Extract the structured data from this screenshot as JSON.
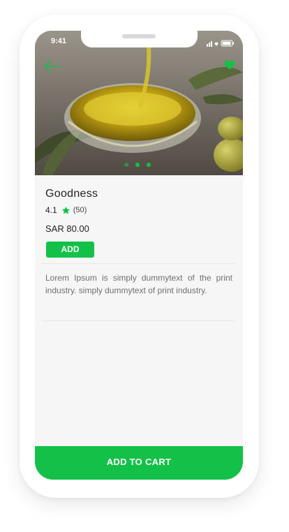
{
  "status_bar": {
    "time": "9:41"
  },
  "product": {
    "name": "Goodness",
    "rating": "4.1",
    "review_count": "(50)",
    "price": "SAR 80.00",
    "add_label": "ADD",
    "description": "Lorem Ipsum is simply dummytext of the print industry. simply dummytext of print industry."
  },
  "carousel": {
    "dots": 3,
    "active_index": 1
  },
  "cart": {
    "label": "ADD TO CART"
  },
  "colors": {
    "accent": "#13c048",
    "favorite": "#13c048"
  },
  "icons": {
    "back": "arrow-left-icon",
    "favorite": "heart-icon",
    "rating": "star-icon"
  }
}
